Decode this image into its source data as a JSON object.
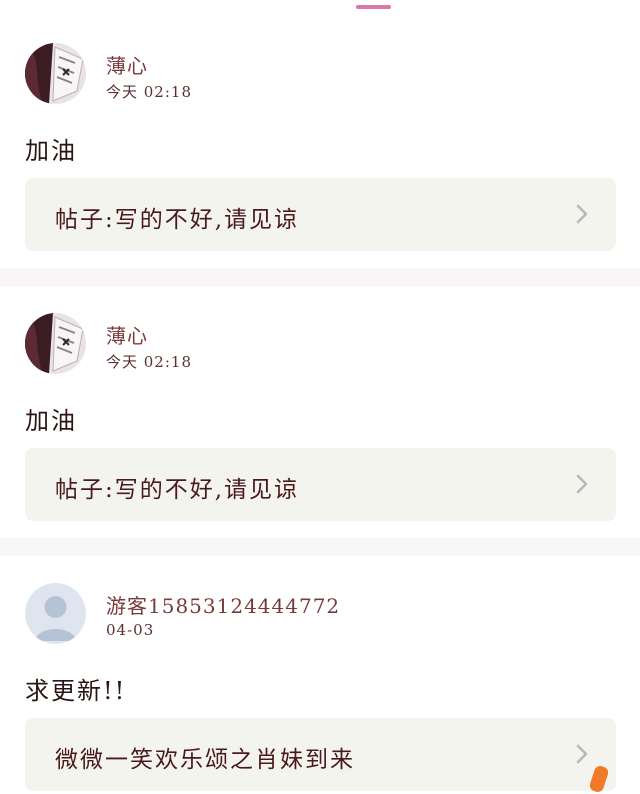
{
  "comments": [
    {
      "username": "薄心",
      "timestamp": "今天 02:18",
      "text": "加油",
      "post_title": "帖子:写的不好,请见谅",
      "avatar": "anime-avatar"
    },
    {
      "username": "薄心",
      "timestamp": "今天 02:18",
      "text": "加油",
      "post_title": "帖子:写的不好,请见谅",
      "avatar": "anime-avatar"
    },
    {
      "username": "游客15853124444772",
      "timestamp": "04-03",
      "text": "求更新!!",
      "post_title": "微微一笑欢乐颂之肖妹到来",
      "avatar": "default-user-avatar"
    }
  ],
  "colors": {
    "tab_indicator": "#d97aa8",
    "card_background": "#f4f4ee",
    "divider": "#f9f6f7",
    "accent_orange": "#f07a2a"
  }
}
